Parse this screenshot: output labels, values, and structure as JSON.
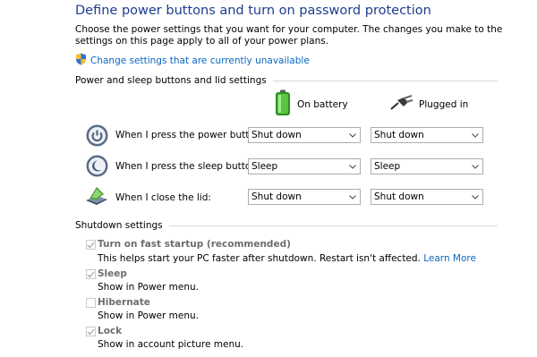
{
  "header": {
    "title": "Define power buttons and turn on password protection",
    "description": "Choose the power settings that you want for your computer. The changes you make to the settings on this page apply to all of your power plans.",
    "change_link": "Change settings that are currently unavailable"
  },
  "power_section": {
    "title": "Power and sleep buttons and lid settings",
    "columns": [
      "On battery",
      "Plugged in"
    ],
    "rows": [
      {
        "label": "When I press the power button:",
        "battery": "Shut down",
        "plugged": "Shut down",
        "icon": "power-button-icon"
      },
      {
        "label": "When I press the sleep button:",
        "battery": "Sleep",
        "plugged": "Sleep",
        "icon": "sleep-button-icon"
      },
      {
        "label": "When I close the lid:",
        "battery": "Shut down",
        "plugged": "Shut down",
        "icon": "laptop-lid-icon"
      }
    ]
  },
  "shutdown_section": {
    "title": "Shutdown settings",
    "items": [
      {
        "label": "Turn on fast startup (recommended)",
        "checked": true,
        "description": "This helps start your PC faster after shutdown. Restart isn't affected.",
        "link": "Learn More"
      },
      {
        "label": "Sleep",
        "checked": true,
        "description": "Show in Power menu.",
        "link": ""
      },
      {
        "label": "Hibernate",
        "checked": false,
        "description": "Show in Power menu.",
        "link": ""
      },
      {
        "label": "Lock",
        "checked": true,
        "description": "Show in account picture menu.",
        "link": ""
      }
    ]
  },
  "colors": {
    "title": "#1e3d8f",
    "link": "#0a66c2",
    "disabled_text": "#6d6d6d",
    "battery_green": "#3cb02c"
  }
}
